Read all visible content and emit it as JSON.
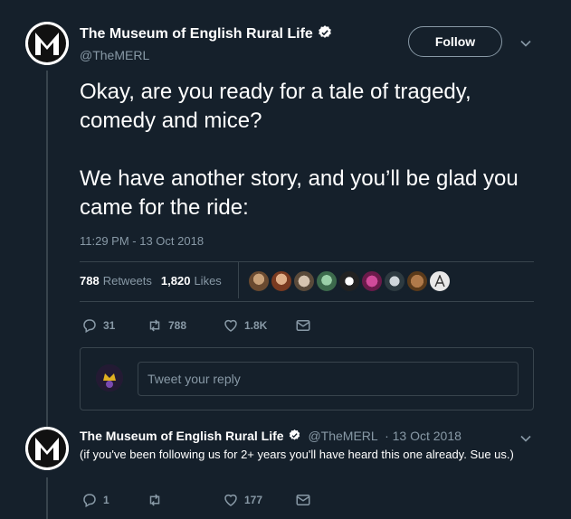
{
  "tweet": {
    "author_name": "The Museum of English Rural Life",
    "author_handle": "@TheMERL",
    "follow_label": "Follow",
    "text": "Okay, are you ready for a tale of tragedy, comedy and mice?\n\nWe have another story, and you’ll be glad you came for the ride:",
    "timestamp": "11:29 PM - 13 Oct 2018",
    "retweets_count": "788",
    "retweets_label": "Retweets",
    "likes_count": "1,820",
    "likes_label": "Likes",
    "actions": {
      "replies": "31",
      "retweets": "788",
      "likes": "1.8K"
    }
  },
  "reply_box": {
    "placeholder": "Tweet your reply"
  },
  "reply": {
    "author_name": "The Museum of English Rural Life",
    "author_handle": "@TheMERL",
    "date": "· 13 Oct 2018",
    "text": "(if you've been following us for 2+ years you'll have heard this one already. Sue us.)",
    "actions": {
      "replies": "1",
      "retweets": "",
      "likes": "177"
    }
  },
  "colors": {
    "background": "#15202b",
    "text": "#ffffff",
    "muted": "#8899a6",
    "border": "#38444d",
    "verified": "#ffffff"
  },
  "icons": [
    "museum-logo-icon",
    "verified-badge-icon",
    "chevron-down-icon",
    "reply-icon",
    "retweet-icon",
    "like-icon",
    "direct-message-icon"
  ]
}
